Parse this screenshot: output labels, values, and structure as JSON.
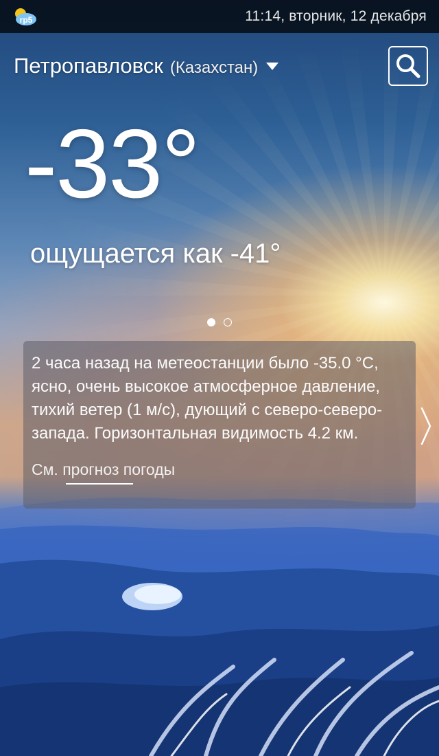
{
  "status_bar": {
    "app_icon_label": "rp5",
    "datetime": "11:14, вторник, 12 декабря"
  },
  "header": {
    "city": "Петропавловск",
    "country": "(Казахстан)",
    "dropdown_icon": "caret-down-icon",
    "search_icon": "search-icon"
  },
  "weather": {
    "temperature": "-33°",
    "feels_like": "ощущается как -41°"
  },
  "pager": {
    "pages": 2,
    "active": 1
  },
  "observation_card": {
    "text": "2 часа назад на метеостанции  было -35.0 °С,  ясно,  очень высокое атмосферное давление, тихий ветер (1 м/с), дующий с северо-северо-запада. Горизонтальная видимость 4.2 км.",
    "forecast_link": "См. прогноз погоды",
    "next_icon": "chevron-right-icon"
  }
}
